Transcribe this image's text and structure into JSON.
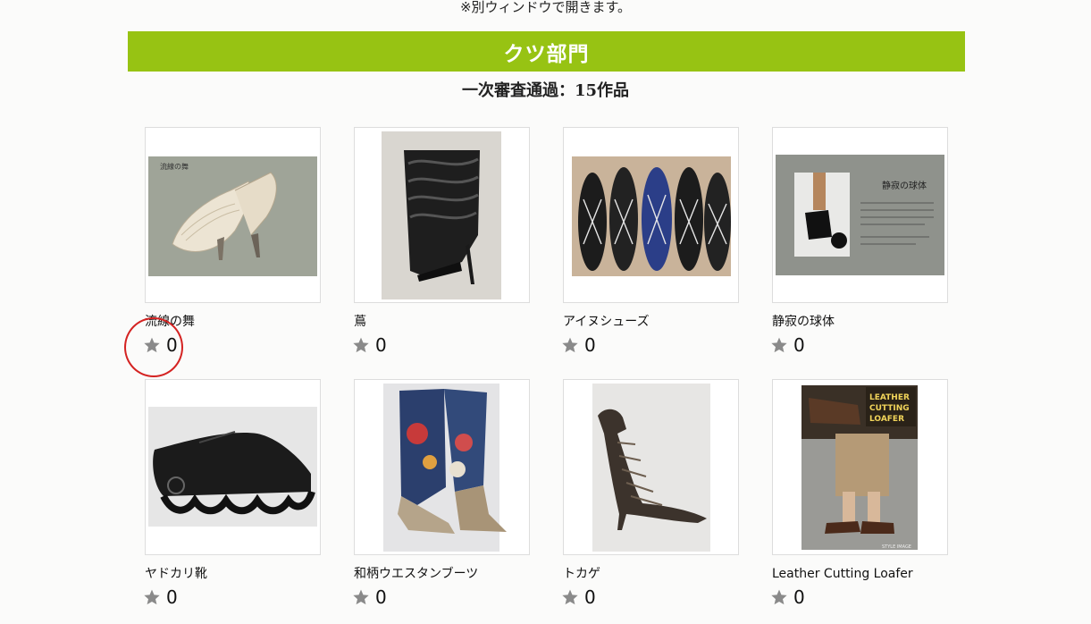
{
  "note": "※別ウィンドウで開きます。",
  "section": {
    "title": "クツ部門",
    "subtitle": "一次審査通過：15作品"
  },
  "items": [
    {
      "title": "流線の舞",
      "votes": "0",
      "image_label": "流線の舞",
      "icon": "star-icon"
    },
    {
      "title": "蔦",
      "votes": "0",
      "icon": "star-icon"
    },
    {
      "title": "アイヌシューズ",
      "votes": "0",
      "icon": "star-icon"
    },
    {
      "title": "静寂の球体",
      "votes": "0",
      "image_label": "静寂の球体",
      "icon": "star-icon"
    },
    {
      "title": "ヤドカリ靴",
      "votes": "0",
      "icon": "star-icon"
    },
    {
      "title": "和柄ウエスタンブーツ",
      "votes": "0",
      "icon": "star-icon"
    },
    {
      "title": "トカゲ",
      "votes": "0",
      "icon": "star-icon"
    },
    {
      "title": "Leather Cutting Loafer",
      "votes": "0",
      "image_label": "LEATHER CUTTING LOAFER",
      "image_caption": "STYLE IMAGE",
      "icon": "star-icon"
    }
  ],
  "colors": {
    "banner": "#97c313",
    "highlight": "#d42322",
    "star": "#8a8a8a"
  }
}
